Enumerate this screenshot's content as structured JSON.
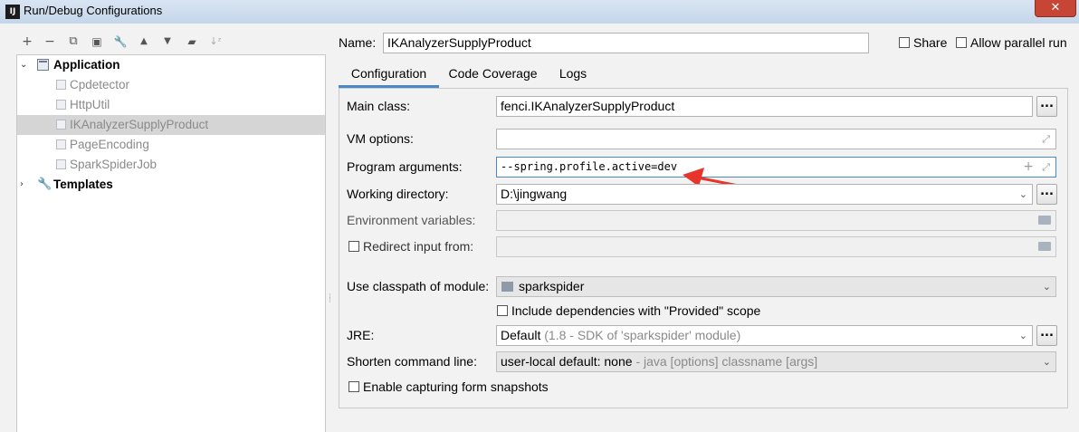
{
  "window": {
    "title": "Run/Debug Configurations",
    "app_icon_text": "IJ",
    "close_glyph": "✕"
  },
  "toolbar": [
    {
      "name": "add-icon",
      "glyph": "+"
    },
    {
      "name": "remove-icon",
      "glyph": "−"
    },
    {
      "name": "copy-icon",
      "glyph": "⧉"
    },
    {
      "name": "save-icon",
      "glyph": "▣"
    },
    {
      "name": "wrench-icon",
      "glyph": "🔧"
    },
    {
      "name": "move-up-icon",
      "glyph": "▲"
    },
    {
      "name": "move-down-icon",
      "glyph": "▼"
    },
    {
      "name": "folder-icon",
      "glyph": "▰"
    },
    {
      "name": "sort-icon",
      "glyph": "↓ᶻ"
    }
  ],
  "tree": {
    "application_label": "Application",
    "children": [
      "Cpdetector",
      "HttpUtil",
      "IKAnalyzerSupplyProduct",
      "PageEncoding",
      "SparkSpiderJob"
    ],
    "templates_label": "Templates"
  },
  "header": {
    "name_label": "Name:",
    "name_value": "IKAnalyzerSupplyProduct",
    "share_label": "Share",
    "parallel_label": "Allow parallel run"
  },
  "tabs": [
    "Configuration",
    "Code Coverage",
    "Logs"
  ],
  "form": {
    "main_class_label": "Main class:",
    "main_class_value": "fenci.IKAnalyzerSupplyProduct",
    "vm_options_label": "VM options:",
    "vm_options_value": "",
    "program_args_label": "Program arguments:",
    "program_args_value": "--spring.profile.active=dev",
    "working_dir_label": "Working directory:",
    "working_dir_value": "D:\\jingwang",
    "env_vars_label": "Environment variables:",
    "env_vars_value": "",
    "redirect_label": "Redirect input from:",
    "classpath_label": "Use classpath of module:",
    "classpath_value": "sparkspider",
    "include_deps_label": "Include dependencies with \"Provided\" scope",
    "jre_label": "JRE:",
    "jre_value": "Default",
    "jre_detail": "(1.8 - SDK of 'sparkspider' module)",
    "shorten_label": "Shorten command line:",
    "shorten_value": "user-local default: none",
    "shorten_detail": "- java [options] classname [args]",
    "capture_label": "Enable capturing form snapshots",
    "browse_label": "..."
  },
  "colors": {
    "accent": "#4a88c7",
    "annotation_arrow": "#e8342a",
    "selection": "#d5d5d5"
  }
}
